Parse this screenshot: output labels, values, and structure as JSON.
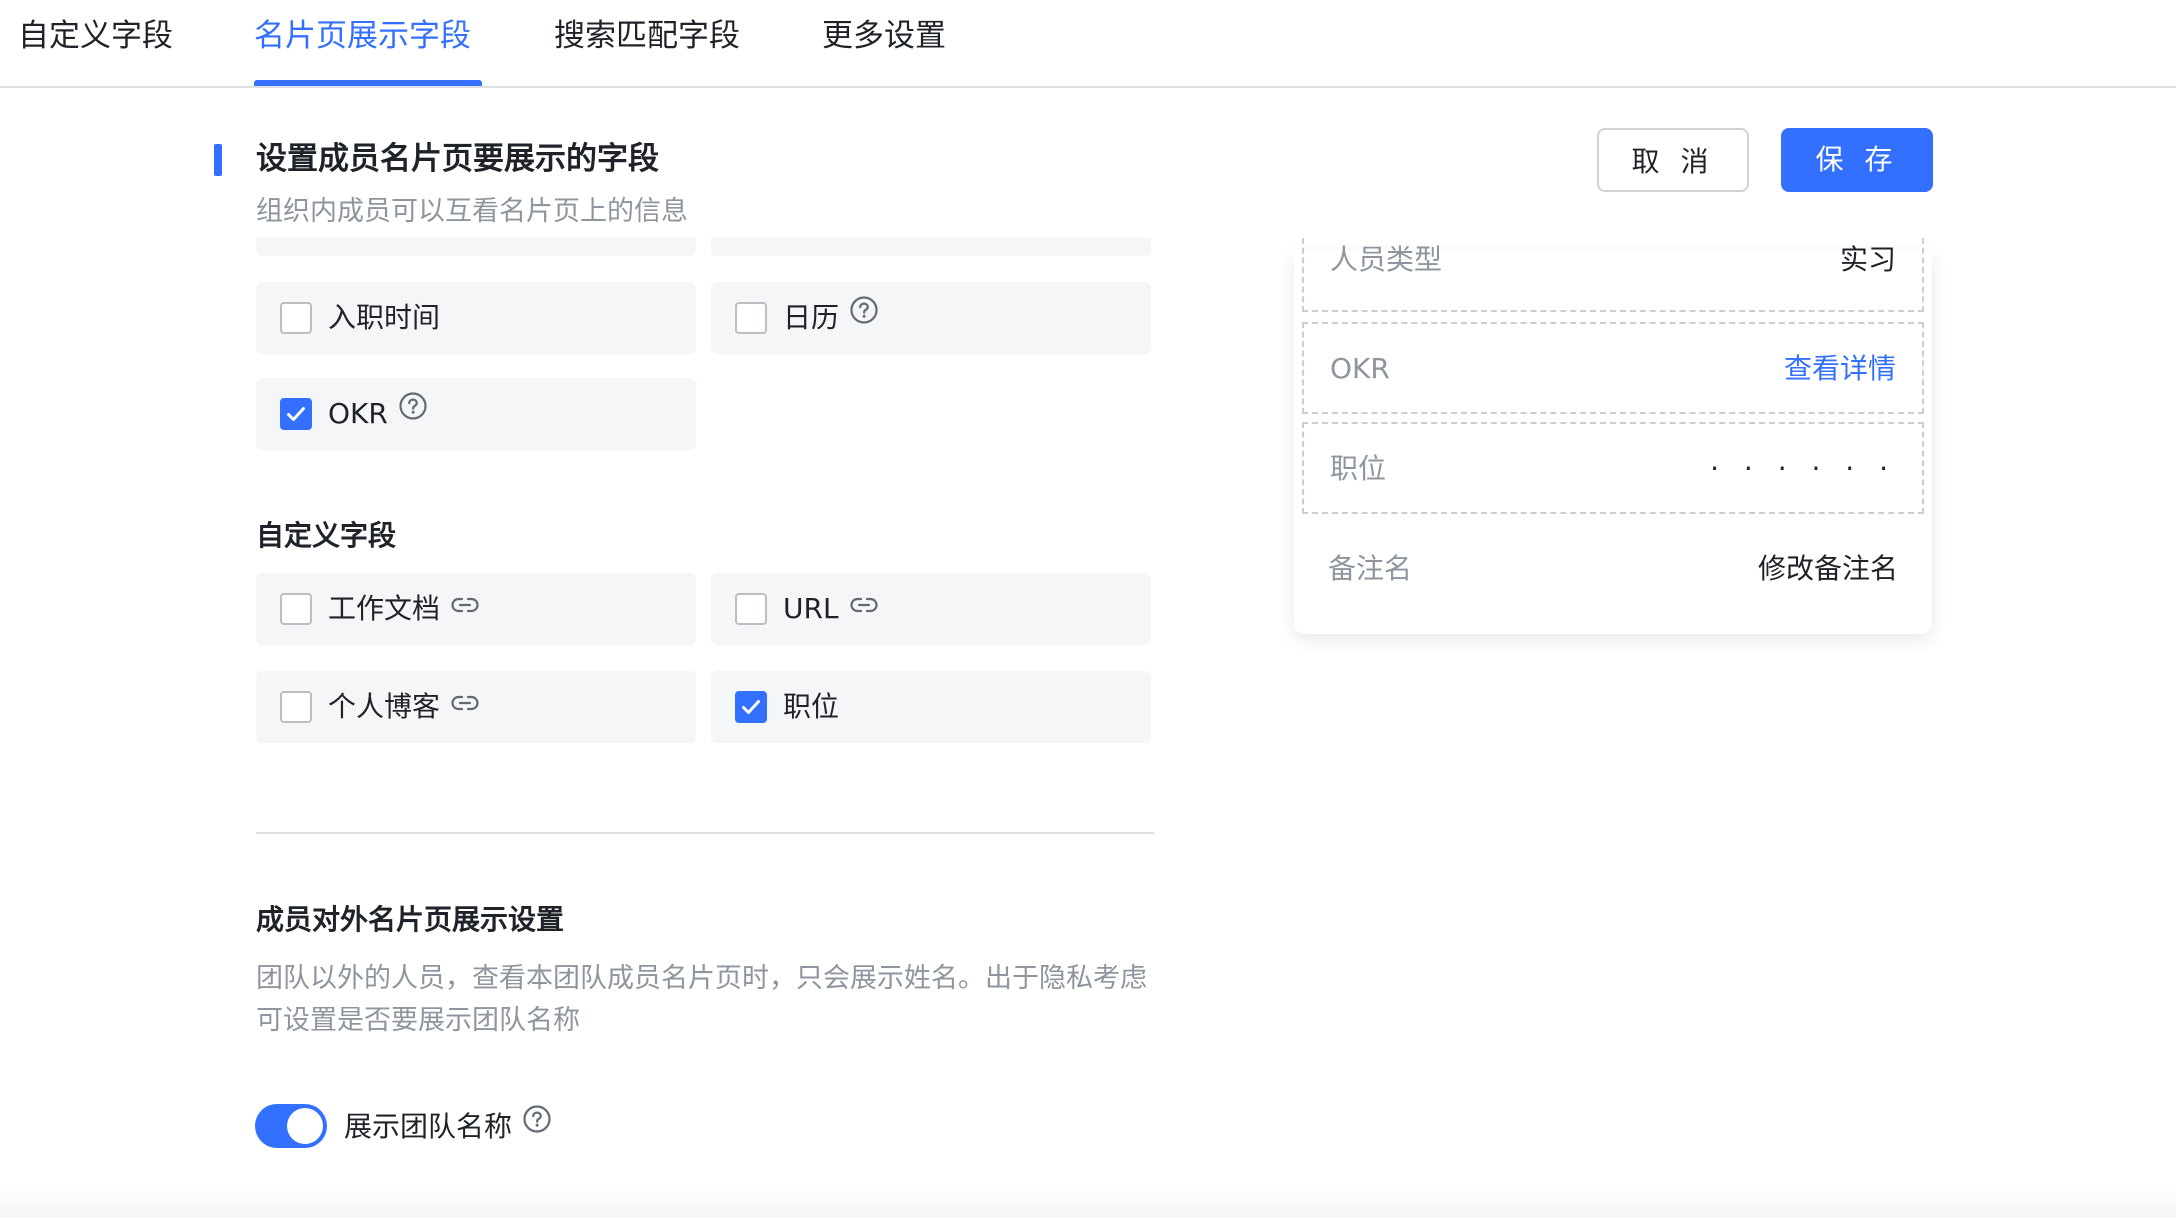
{
  "tabs": [
    {
      "label": "自定义字段"
    },
    {
      "label": "名片页展示字段"
    },
    {
      "label": "搜索匹配字段"
    },
    {
      "label": "更多设置"
    }
  ],
  "active_tab": "名片页展示字段",
  "header": {
    "title": "设置成员名片页要展示的字段",
    "desc": "组织内成员可以互看名片页上的信息",
    "cancel_label": "取 消",
    "save_label": "保 存"
  },
  "system_fields": [
    {
      "label": "入职时间",
      "checked": false,
      "icon": "none"
    },
    {
      "label": "日历",
      "checked": false,
      "icon": "help-icon"
    },
    {
      "label": "OKR",
      "checked": true,
      "icon": "help-icon"
    }
  ],
  "custom_section": {
    "title": "自定义字段",
    "fields": [
      {
        "label": "工作文档",
        "checked": false,
        "icon": "link-icon"
      },
      {
        "label": "URL",
        "checked": false,
        "icon": "link-icon"
      },
      {
        "label": "个人博客",
        "checked": false,
        "icon": "link-icon"
      },
      {
        "label": "职位",
        "checked": true,
        "icon": "none"
      }
    ]
  },
  "external": {
    "title": "成员对外名片页展示设置",
    "desc": "团队以外的人员，查看本团队成员名片页时，只会展示姓名。出于隐私考虑可设置是否要展示团队名称",
    "toggle_label": "展示团队名称",
    "toggle_on": true
  },
  "preview": {
    "rows": [
      {
        "label": "人员类型",
        "value": "实习"
      },
      {
        "label": "OKR",
        "value": "查看详情"
      },
      {
        "label": "职位",
        "value": "· · · · · ·"
      },
      {
        "label": "备注名",
        "value": "修改备注名"
      }
    ]
  },
  "colors": {
    "accent": "#3370ff",
    "card_bg": "#f5f6f7",
    "muted_text": "#8f959e"
  }
}
